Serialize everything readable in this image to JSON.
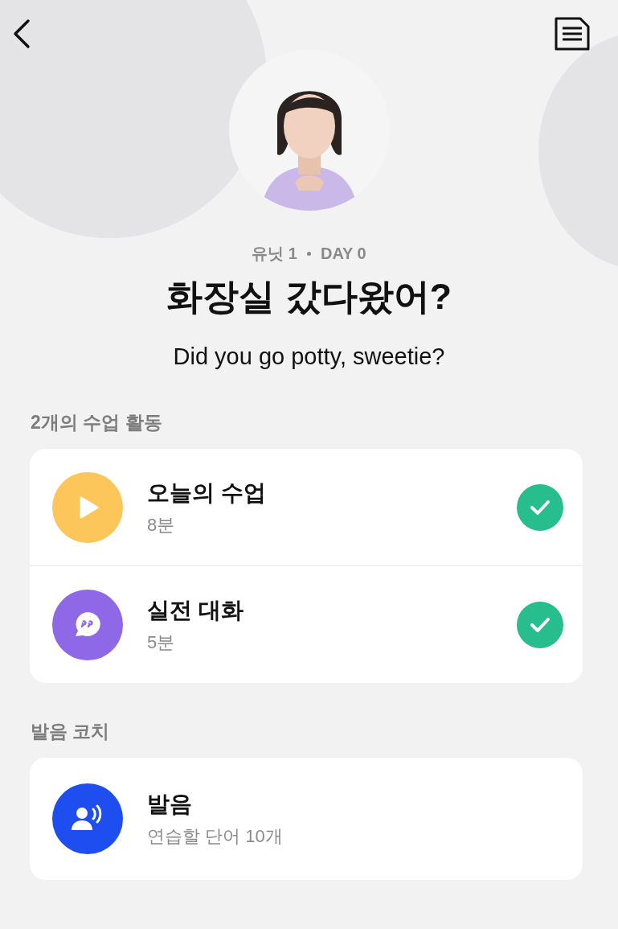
{
  "header": {
    "unit": "유닛 1",
    "day": "DAY 0",
    "title": "화장실 갔다왔어?",
    "subtitle": "Did you go potty, sweetie?"
  },
  "sections": [
    {
      "heading": "2개의 수업 활동",
      "items": [
        {
          "kind": "video",
          "title": "오늘의 수업",
          "detail": "8분",
          "color": "#fdc65a",
          "completed": true
        },
        {
          "kind": "chat",
          "title": "실전 대화",
          "detail": "5분",
          "color": "#8f68e8",
          "completed": true
        }
      ]
    },
    {
      "heading": "발음 코치",
      "items": [
        {
          "kind": "speech",
          "title": "발음",
          "detail": "연습할 단어 10개",
          "color": "#1f4ef0",
          "completed": false
        }
      ]
    }
  ]
}
